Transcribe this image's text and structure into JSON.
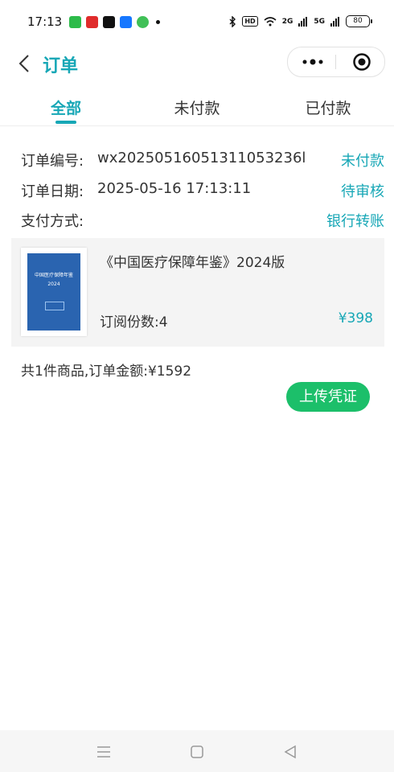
{
  "status_bar": {
    "time": "17:13",
    "signal_1": "2G",
    "signal_2": "5G",
    "hd_label": "HD",
    "battery": "80"
  },
  "nav": {
    "title": "订单"
  },
  "tabs": [
    {
      "label": "全部",
      "active": true
    },
    {
      "label": "未付款",
      "active": false
    },
    {
      "label": "已付款",
      "active": false
    }
  ],
  "order": {
    "number_label": "订单编号:",
    "number_value": "wx20250516051311053236l",
    "payment_status": "未付款",
    "date_label": "订单日期:",
    "date_value": "2025-05-16 17:13:11",
    "review_status": "待审核",
    "pay_method_label": "支付方式:",
    "pay_method_value": "银行转账"
  },
  "product": {
    "name": "《中国医疗保障年鉴》2024版",
    "qty_text": "订阅份数:4",
    "price": "¥398",
    "cover_title": "中国医疗保障年鉴",
    "cover_year": "2024"
  },
  "summary": {
    "text": "共1件商品,订单金额:¥1592"
  },
  "upload_button": "上传凭证",
  "colors": {
    "accent": "#17a7b6",
    "button_green": "#1cbf6a"
  }
}
